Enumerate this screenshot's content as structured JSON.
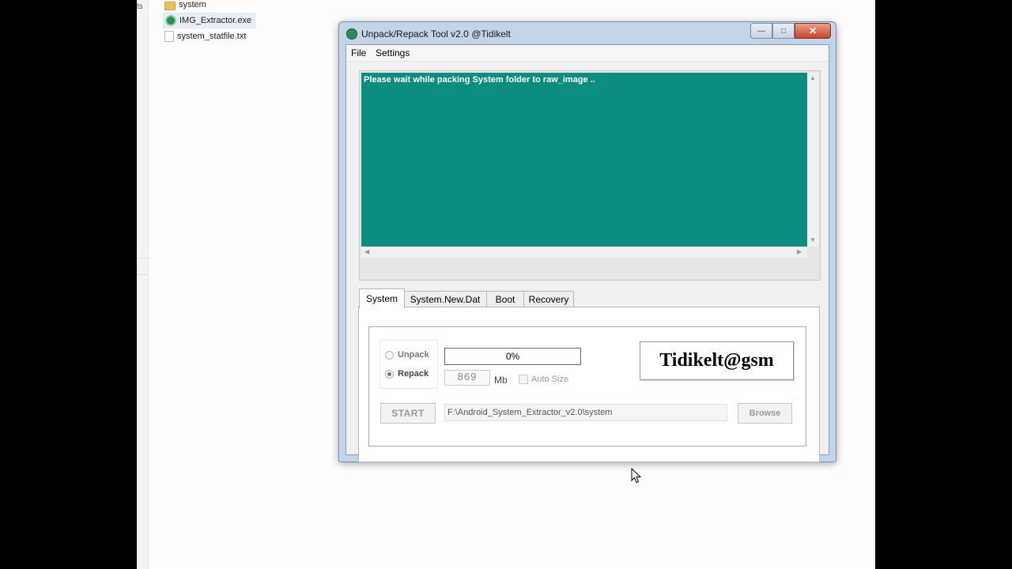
{
  "background_files": [
    {
      "name": "system",
      "icon": "folder-icon"
    },
    {
      "name": "IMG_Extractor.exe",
      "icon": "exe-icon"
    },
    {
      "name": "system_statfile.txt",
      "icon": "text-file-icon"
    }
  ],
  "edge_text": "ts",
  "window": {
    "title": "Unpack/Repack Tool  v2.0  @Tidikelt",
    "minimize_symbol": "—",
    "maximize_symbol": "□",
    "close_symbol": "✕"
  },
  "menu": {
    "file": "File",
    "settings": "Settings"
  },
  "log": {
    "message": "Please wait while packing System folder to raw_image .."
  },
  "tabs": [
    "System",
    "System.New.Dat",
    "Boot",
    "Recovery"
  ],
  "panel": {
    "mode_options": [
      "Unpack",
      "Repack"
    ],
    "selected_mode": "Repack",
    "progress_text": "0%",
    "progress_fraction": 0,
    "size_value": "869",
    "size_unit": "Mb",
    "auto_size_label": "Auto Size",
    "brand": "Tidikelt@gsm",
    "start_label": "START",
    "path_value": "F:\\Android_System_Extractor_v2.0\\system",
    "browse_label": "Browse"
  },
  "colors": {
    "log_background": "#0d8c80",
    "progress_fill": "#3cb043"
  }
}
